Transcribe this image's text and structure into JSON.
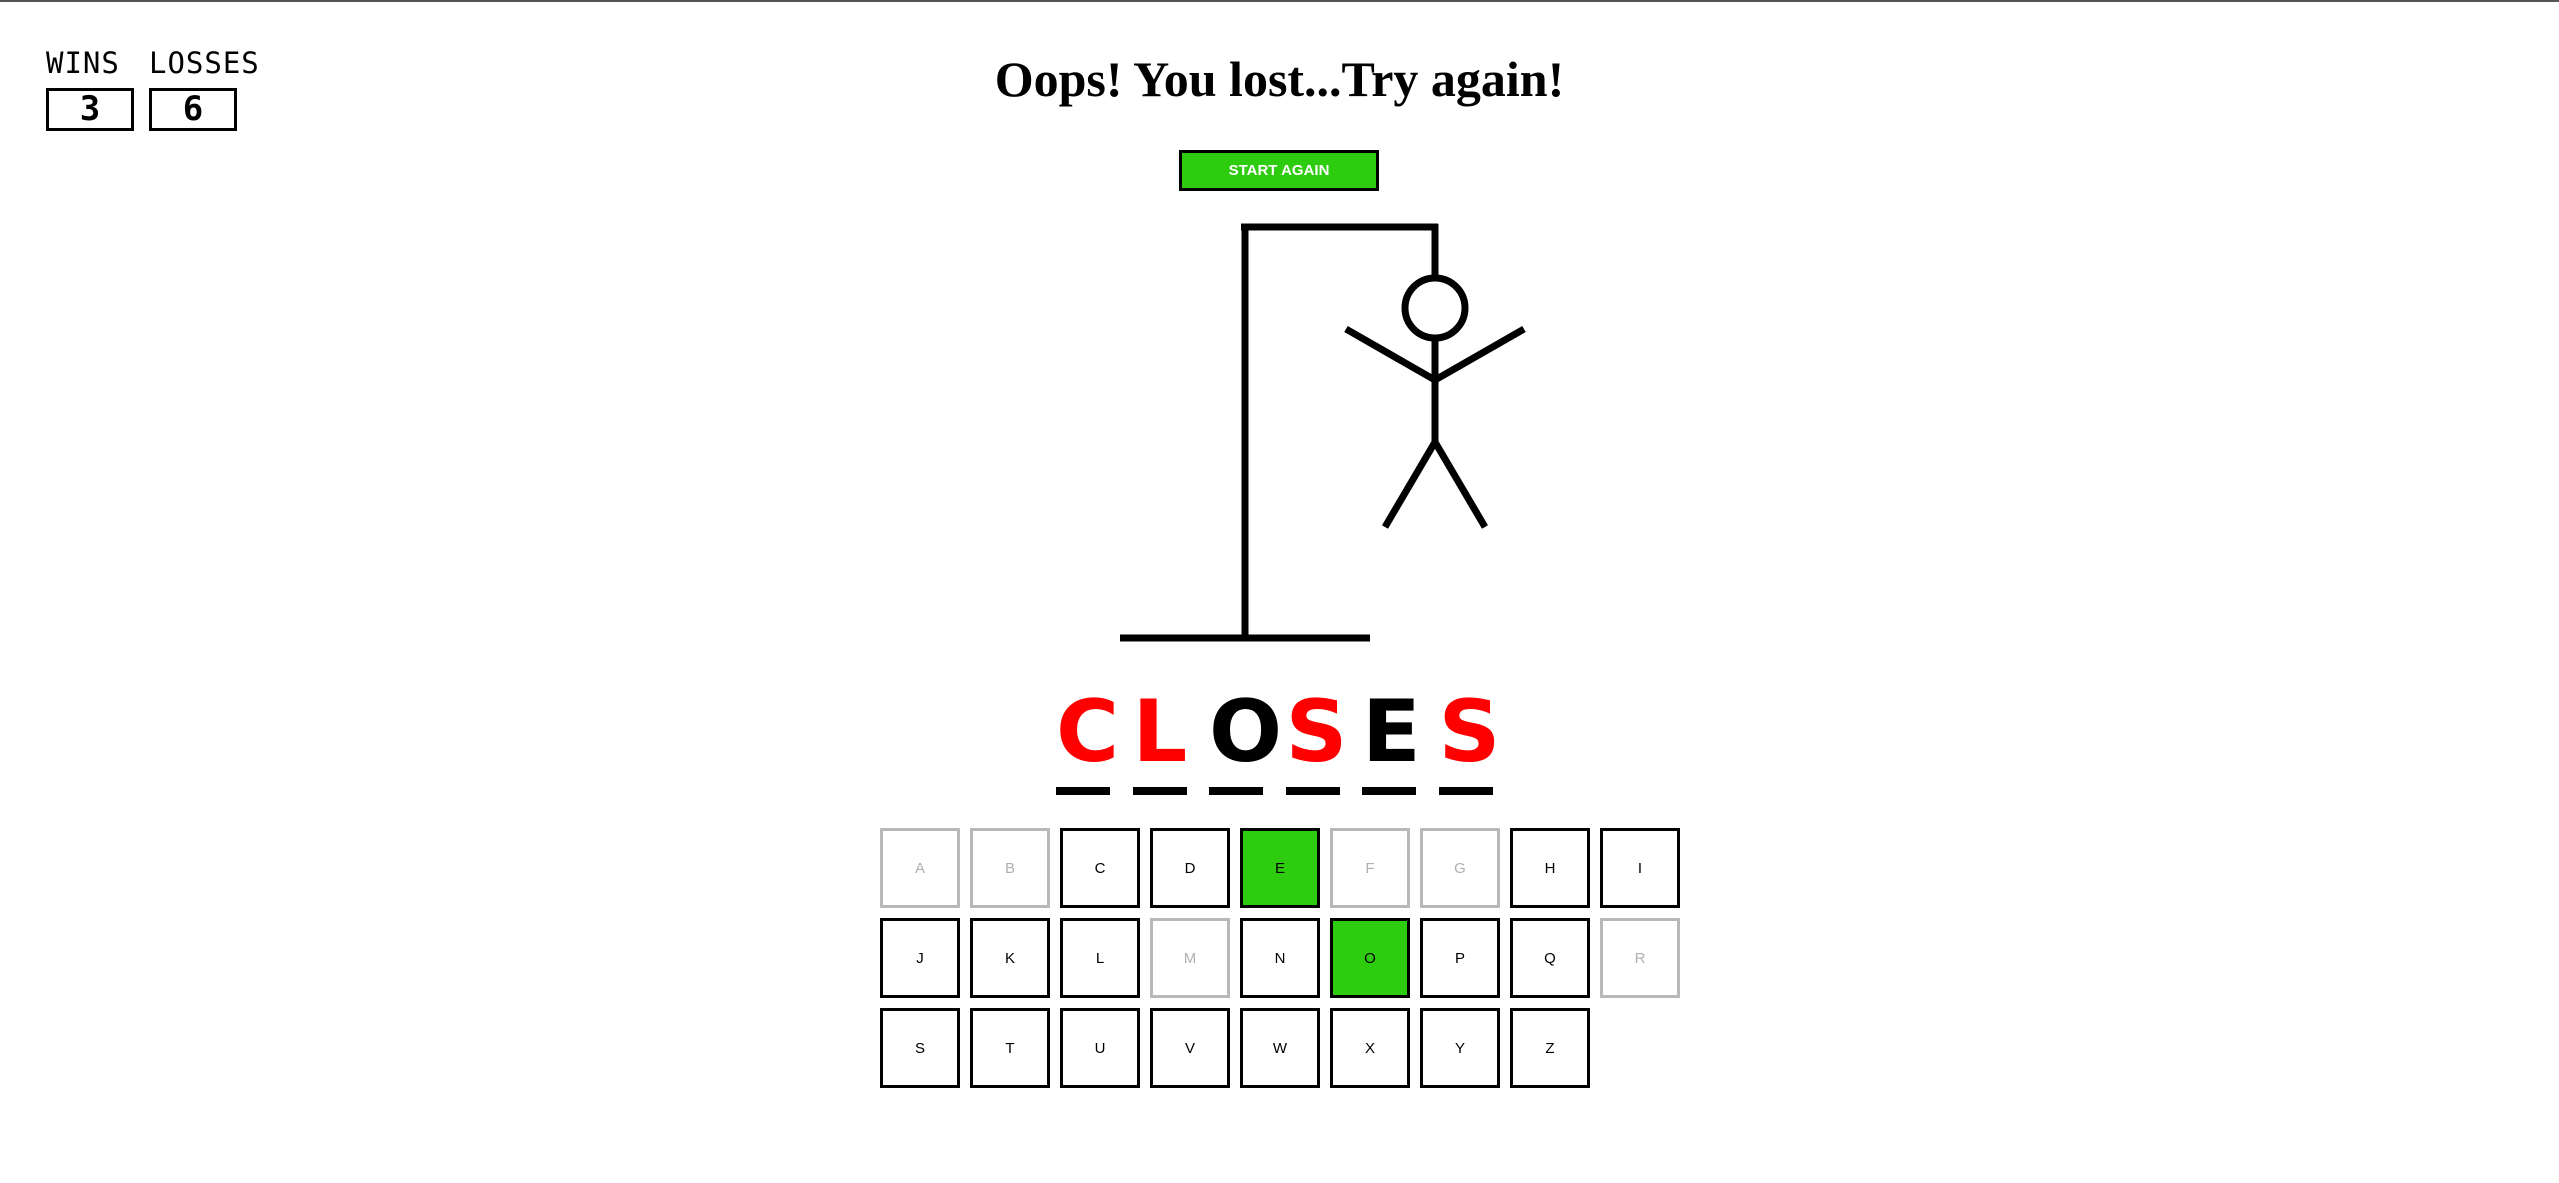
{
  "score": {
    "wins_label": "WINS",
    "wins": "3",
    "losses_label": "LOSSES",
    "losses": "6"
  },
  "status_message": "Oops! You lost...Try again!",
  "start_button_label": "START AGAIN",
  "word": [
    {
      "letter": "C",
      "guessed": false
    },
    {
      "letter": "L",
      "guessed": false
    },
    {
      "letter": "O",
      "guessed": true
    },
    {
      "letter": "S",
      "guessed": false
    },
    {
      "letter": "E",
      "guessed": true
    },
    {
      "letter": "S",
      "guessed": false
    }
  ],
  "keys": [
    {
      "letter": "A",
      "state": "used"
    },
    {
      "letter": "B",
      "state": "used"
    },
    {
      "letter": "C",
      "state": "available"
    },
    {
      "letter": "D",
      "state": "available"
    },
    {
      "letter": "E",
      "state": "correct"
    },
    {
      "letter": "F",
      "state": "used"
    },
    {
      "letter": "G",
      "state": "used"
    },
    {
      "letter": "H",
      "state": "available"
    },
    {
      "letter": "I",
      "state": "available"
    },
    {
      "letter": "J",
      "state": "available"
    },
    {
      "letter": "K",
      "state": "available"
    },
    {
      "letter": "L",
      "state": "available"
    },
    {
      "letter": "M",
      "state": "used"
    },
    {
      "letter": "N",
      "state": "available"
    },
    {
      "letter": "O",
      "state": "correct"
    },
    {
      "letter": "P",
      "state": "available"
    },
    {
      "letter": "Q",
      "state": "available"
    },
    {
      "letter": "R",
      "state": "used"
    },
    {
      "letter": "S",
      "state": "available"
    },
    {
      "letter": "T",
      "state": "available"
    },
    {
      "letter": "U",
      "state": "available"
    },
    {
      "letter": "V",
      "state": "available"
    },
    {
      "letter": "W",
      "state": "available"
    },
    {
      "letter": "X",
      "state": "available"
    },
    {
      "letter": "Y",
      "state": "available"
    },
    {
      "letter": "Z",
      "state": "available"
    }
  ],
  "colors": {
    "correct_key": "#2ecc0f",
    "start_button": "#2ecc0f",
    "missed_letter": "#ff0000",
    "guessed_letter": "#000000",
    "used_key_border": "#b8b8b8"
  }
}
